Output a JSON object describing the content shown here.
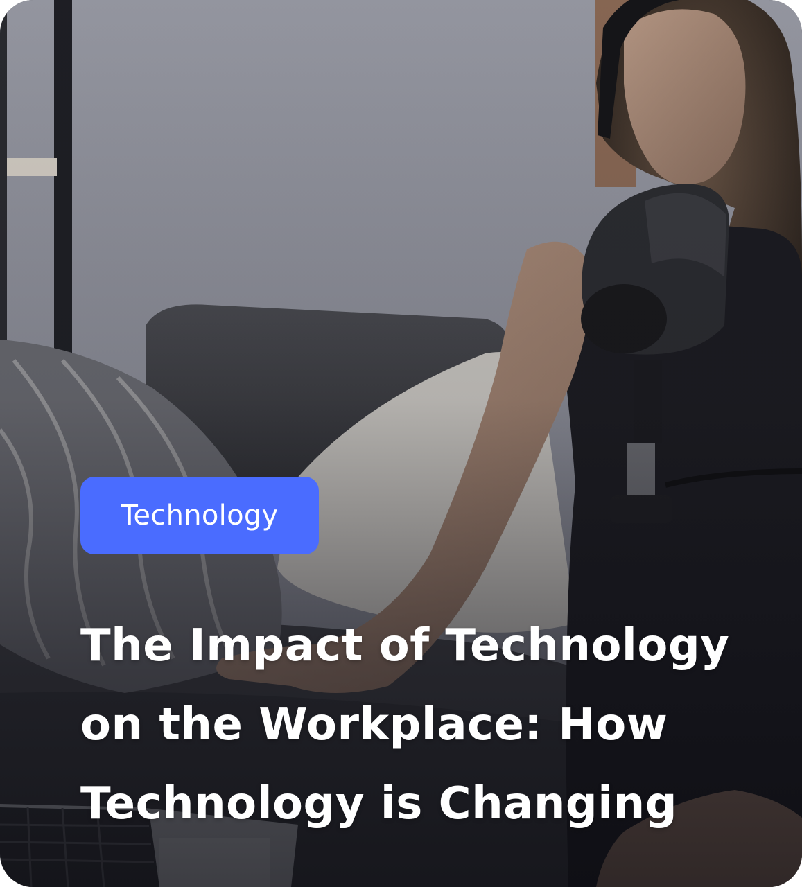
{
  "card": {
    "category": "Technology",
    "title": "The Impact of Technology on the Workplace: How Technology is Changing"
  },
  "colors": {
    "tag_background": "#4a6cff",
    "text": "#ffffff"
  },
  "icons": {
    "photo": "podcast-photo"
  }
}
